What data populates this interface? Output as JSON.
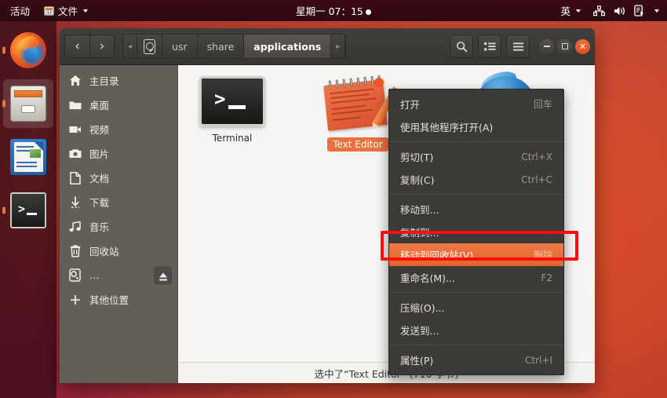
{
  "topbar": {
    "activities": "活动",
    "app_icon": "files-icon",
    "app_menu": "文件",
    "clock": "星期一 07：15",
    "input_method": "英",
    "icons": [
      "network-icon",
      "volume-icon",
      "power-icon",
      "chevron-down-icon"
    ]
  },
  "dock": {
    "items": [
      {
        "name": "firefox",
        "label": "Firefox",
        "running": true,
        "active": false
      },
      {
        "name": "files",
        "label": "文件",
        "running": true,
        "active": true
      },
      {
        "name": "libreoffice-writer",
        "label": "LibreOffice Writer",
        "running": false,
        "active": false
      },
      {
        "name": "terminal",
        "label": "Terminal",
        "running": true,
        "active": false
      }
    ]
  },
  "window": {
    "title": "applications",
    "nav": {
      "back": "‹",
      "forward": "›"
    },
    "breadcrumb": {
      "left_arrow": "◂",
      "device_icon": "hdd-icon",
      "items": [
        "usr",
        "share",
        "applications"
      ],
      "current": "applications",
      "right_arrow": "▸"
    },
    "toolbar": {
      "search": "search-icon",
      "view_list": "list-view-icon",
      "menu": "hamburger-menu-icon"
    },
    "controls": {
      "minimize": "−",
      "maximize": "□",
      "close": "✕"
    }
  },
  "sidebar": {
    "items": [
      {
        "label": "主目录",
        "icon": "home-icon"
      },
      {
        "label": "桌面",
        "icon": "desktop-folder-icon"
      },
      {
        "label": "视频",
        "icon": "videos-icon"
      },
      {
        "label": "图片",
        "icon": "pictures-icon"
      },
      {
        "label": "文档",
        "icon": "documents-icon"
      },
      {
        "label": "下载",
        "icon": "downloads-icon"
      },
      {
        "label": "音乐",
        "icon": "music-icon"
      },
      {
        "label": "回收站",
        "icon": "trash-icon"
      },
      {
        "label": "…",
        "icon": "hdd-icon",
        "eject": true
      },
      {
        "label": "其他位置",
        "icon": "plus-icon"
      }
    ]
  },
  "files": [
    {
      "name": "Terminal",
      "icon": "terminal-icon",
      "selected": false
    },
    {
      "name": "Text Editor",
      "icon": "text-editor-icon",
      "selected": true
    }
  ],
  "context_menu": {
    "groups": [
      [
        {
          "label": "打开",
          "accel": "回车",
          "selected": false
        },
        {
          "label": "使用其他程序打开(A)",
          "accel": "",
          "selected": false
        }
      ],
      [
        {
          "label": "剪切(T)",
          "accel": "Ctrl+X",
          "selected": false
        },
        {
          "label": "复制(C)",
          "accel": "Ctrl+C",
          "selected": false
        }
      ],
      [
        {
          "label": "移动到...",
          "accel": "",
          "selected": false
        },
        {
          "label": "复制到...",
          "accel": "",
          "selected": false
        },
        {
          "label": "移动到回收站(V)",
          "accel": "删除",
          "selected": true
        },
        {
          "label": "重命名(M)...",
          "accel": "F2",
          "selected": false
        }
      ],
      [
        {
          "label": "压缩(O)...",
          "accel": "",
          "selected": false
        },
        {
          "label": "发送到...",
          "accel": "",
          "selected": false
        }
      ],
      [
        {
          "label": "属性(P)",
          "accel": "Ctrl+I",
          "selected": false
        }
      ]
    ]
  },
  "statusbar": {
    "text": "选中了“Text Editor” (710 字节)"
  },
  "annotation": {
    "color": "#fd0d0d",
    "target": "移动到回收站(V)"
  },
  "colors": {
    "accent_orange": "#e8713e",
    "topbar": "#2c0a12",
    "sidebar": "#635f58",
    "headerbar": "#3c3a37",
    "menu_bg": "#3c3a37"
  }
}
